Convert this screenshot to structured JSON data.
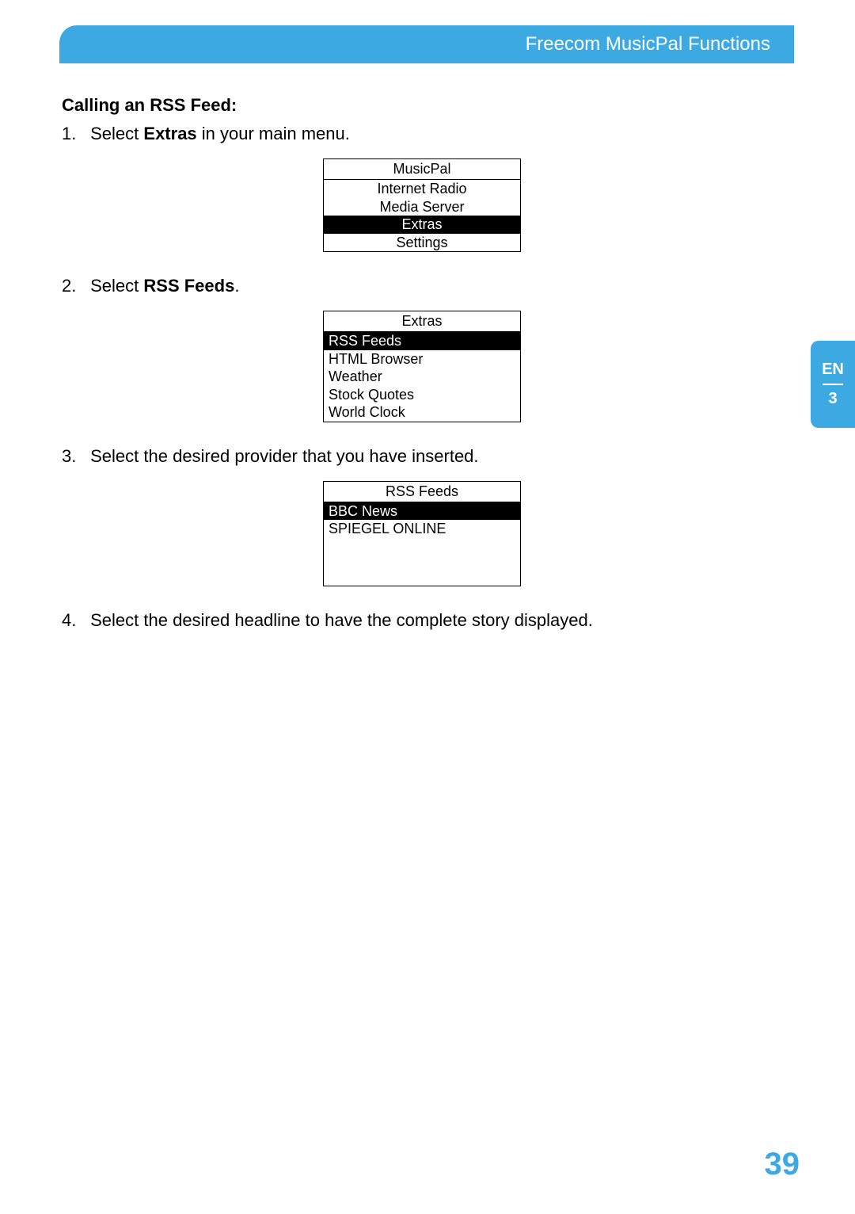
{
  "header": {
    "title": "Freecom MusicPal Functions"
  },
  "sideTab": {
    "lang": "EN",
    "chapter": "3"
  },
  "section": {
    "title": "Calling an RSS Feed:"
  },
  "steps": {
    "s1": {
      "num": "1.",
      "pre": "Select ",
      "bold": "Extras",
      "post": " in your main menu."
    },
    "s2": {
      "num": "2.",
      "pre": "Select ",
      "bold": "RSS Feeds",
      "post": "."
    },
    "s3": {
      "num": "3.",
      "text": "Select the desired provider that you have inserted."
    },
    "s4": {
      "num": "4.",
      "text": "Select the desired headline to have the complete story displayed."
    }
  },
  "box1": {
    "title": "MusicPal",
    "items": [
      {
        "label": "Internet Radio",
        "selected": false
      },
      {
        "label": "Media Server",
        "selected": false
      },
      {
        "label": "Extras",
        "selected": true
      },
      {
        "label": "Settings",
        "selected": false
      }
    ]
  },
  "box2": {
    "title": "Extras",
    "items": [
      {
        "label": "RSS Feeds",
        "selected": true
      },
      {
        "label": "HTML Browser",
        "selected": false
      },
      {
        "label": "Weather",
        "selected": false
      },
      {
        "label": "Stock Quotes",
        "selected": false
      },
      {
        "label": "World Clock",
        "selected": false
      }
    ]
  },
  "box3": {
    "title": "RSS Feeds",
    "items": [
      {
        "label": "BBC News",
        "selected": true
      },
      {
        "label": "SPIEGEL ONLINE",
        "selected": false
      }
    ]
  },
  "pageNumber": "39"
}
